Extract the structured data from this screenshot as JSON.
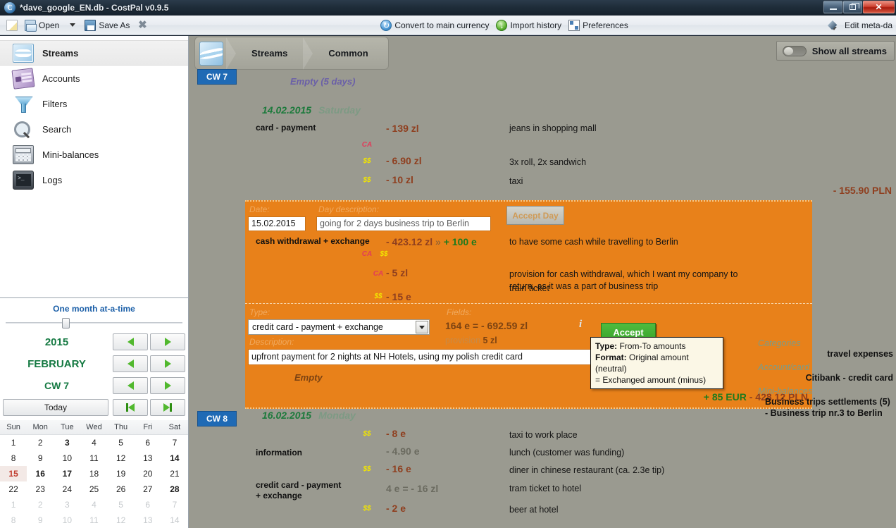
{
  "window": {
    "title": "*dave_google_EN.db - CostPal v0.9.5",
    "icon": "app-icon",
    "minimize": "minimize",
    "maximize": "restore",
    "close": "close"
  },
  "toolbar": {
    "new_label": "",
    "open_label": "Open",
    "save_as_label": "Save As",
    "close_db_label": "",
    "convert_label": "Convert to main currency",
    "import_label": "Import history",
    "preferences_label": "Preferences",
    "edit_meta_label": "Edit meta-da"
  },
  "sidebar": {
    "items": [
      {
        "label": "Streams",
        "icon": "streams-icon",
        "selected": true
      },
      {
        "label": "Accounts",
        "icon": "accounts-icon",
        "selected": false
      },
      {
        "label": "Filters",
        "icon": "filters-icon",
        "selected": false
      },
      {
        "label": "Search",
        "icon": "search-icon",
        "selected": false
      },
      {
        "label": "Mini-balances",
        "icon": "mini-balances-icon",
        "selected": false
      },
      {
        "label": "Logs",
        "icon": "logs-icon",
        "selected": false
      }
    ]
  },
  "calendar": {
    "granularity_label": "One month at-a-time",
    "year": "2015",
    "month": "FEBRUARY",
    "week": "CW 7",
    "today_label": "Today",
    "weekday_headers": [
      "Sun",
      "Mon",
      "Tue",
      "Wed",
      "Thu",
      "Fri",
      "Sat"
    ],
    "weeks": [
      [
        {
          "d": "1",
          "s": "normal"
        },
        {
          "d": "2",
          "s": "normal"
        },
        {
          "d": "3",
          "s": "bold"
        },
        {
          "d": "4",
          "s": "normal"
        },
        {
          "d": "5",
          "s": "normal"
        },
        {
          "d": "6",
          "s": "normal"
        },
        {
          "d": "7",
          "s": "normal"
        }
      ],
      [
        {
          "d": "8",
          "s": "normal"
        },
        {
          "d": "9",
          "s": "normal"
        },
        {
          "d": "10",
          "s": "normal"
        },
        {
          "d": "11",
          "s": "normal"
        },
        {
          "d": "12",
          "s": "normal"
        },
        {
          "d": "13",
          "s": "normal"
        },
        {
          "d": "14",
          "s": "bold"
        }
      ],
      [
        {
          "d": "15",
          "s": "selected"
        },
        {
          "d": "16",
          "s": "bold"
        },
        {
          "d": "17",
          "s": "bold"
        },
        {
          "d": "18",
          "s": "normal"
        },
        {
          "d": "19",
          "s": "normal"
        },
        {
          "d": "20",
          "s": "normal"
        },
        {
          "d": "21",
          "s": "normal"
        }
      ],
      [
        {
          "d": "22",
          "s": "normal"
        },
        {
          "d": "23",
          "s": "normal"
        },
        {
          "d": "24",
          "s": "normal"
        },
        {
          "d": "25",
          "s": "normal"
        },
        {
          "d": "26",
          "s": "normal"
        },
        {
          "d": "27",
          "s": "normal"
        },
        {
          "d": "28",
          "s": "bold"
        }
      ],
      [
        {
          "d": "1",
          "s": "muted"
        },
        {
          "d": "2",
          "s": "muted"
        },
        {
          "d": "3",
          "s": "muted"
        },
        {
          "d": "4",
          "s": "muted"
        },
        {
          "d": "5",
          "s": "muted"
        },
        {
          "d": "6",
          "s": "muted"
        },
        {
          "d": "7",
          "s": "muted"
        }
      ],
      [
        {
          "d": "8",
          "s": "muted"
        },
        {
          "d": "9",
          "s": "muted"
        },
        {
          "d": "10",
          "s": "muted"
        },
        {
          "d": "11",
          "s": "muted"
        },
        {
          "d": "12",
          "s": "muted"
        },
        {
          "d": "13",
          "s": "muted"
        },
        {
          "d": "14",
          "s": "muted"
        }
      ]
    ]
  },
  "breadcrumb": {
    "logo": "streams-logo",
    "items": [
      "Streams",
      "Common"
    ]
  },
  "show_all_streams": {
    "label": "Show all streams",
    "state": "off"
  },
  "stream": {
    "week_badge_top": "CW 7",
    "week_badge_bottom": "CW 8",
    "empty_note": "Empty (5 days)",
    "day1": {
      "date": "14.02.2015",
      "weekday": "Saturday",
      "rows": [
        {
          "type": "card - payment",
          "flag": "",
          "amount": "- 139 zl",
          "desc": "jeans in shopping mall"
        },
        {
          "type": "",
          "flag": "CA",
          "amount": "",
          "desc": ""
        },
        {
          "type": "",
          "flag": "$$",
          "amount": "- 6.90 zl",
          "desc": "3x roll, 2x sandwich"
        },
        {
          "type": "",
          "flag": "$$",
          "amount": "- 10 zl",
          "desc": "taxi"
        }
      ],
      "total": "- 155.90 PLN"
    },
    "day2": {
      "date": "16.02.2015",
      "weekday": "Monday",
      "rows": [
        {
          "type": "",
          "flag": "$$",
          "amount": "- 8 e",
          "desc": "taxi to work place"
        },
        {
          "type": "information",
          "flag": "",
          "amount": "- 4.90 e",
          "desc": "lunch (customer was funding)"
        },
        {
          "type": "",
          "flag": "$$",
          "amount": "- 16 e",
          "desc": "diner in chinese restaurant (ca. 2.3e tip)"
        },
        {
          "type": "credit card - payment + exchange",
          "flag": "",
          "amount": "4 e = - 16 zl",
          "desc": "tram ticket to hotel"
        },
        {
          "type": "",
          "flag": "$$",
          "amount": "- 2 e",
          "desc": "beer at hotel"
        }
      ]
    }
  },
  "edit_panel": {
    "date_label": "Date:",
    "date_value": "15.02.2015",
    "day_desc_label": "Day description:",
    "day_desc_value": "going for 2 days business trip to Berlin",
    "accept_day_label": "Accept Day",
    "rows": [
      {
        "type": "cash withdrawal + exchange",
        "flag": "",
        "amount_from": "- 423.12 zl",
        "amount_sep": "»",
        "amount_to": "+ 100 e",
        "desc": "to have some cash while travelling to Berlin"
      },
      {
        "type": "",
        "flag": "CA $$",
        "amount_from": "",
        "amount_sep": "",
        "amount_to": "",
        "desc": ""
      },
      {
        "type": "",
        "flag": "CA",
        "amount_from": "- 5 zl",
        "amount_sep": "",
        "amount_to": "",
        "desc": "provision for cash withdrawal, which I want my company to return, as it was a part of business trip"
      },
      {
        "type": "",
        "flag": "$$",
        "amount_from": "- 15 e",
        "amount_sep": "",
        "amount_to": "",
        "desc": "train ticket"
      }
    ],
    "type_label": "Type:",
    "type_value": "credit card - payment + exchange",
    "description_label": "Description:",
    "description_value": "upfront payment for 2 nights at NH Hotels, using my polish credit card",
    "fields_label": "Fields:",
    "fields_value": "164 e = - 692.59 zl",
    "fields_provision_prefix": "provision",
    "fields_provision_value": "5 zl",
    "info_icon": "i",
    "accept_label": "Accept",
    "empty_label": "Empty",
    "total_eur": "+ 85 EUR",
    "total_pln": "- 428.12 PLN"
  },
  "tooltip": {
    "line1_label": "Type:",
    "line1_value": "From-To amounts",
    "line2_label": "Format:",
    "line2_value": "Original amount (neutral)",
    "line3": "= Exchanged amount (minus)"
  },
  "meta": {
    "categories_label": "Categories",
    "categories_value": "travel expenses",
    "account_label": "Account/card",
    "account_value": "Citibank - credit card",
    "minibalances_label": "Mini-balances",
    "minibalances_value": "Business trips settlements (5) - Business trip nr.3 to Berlin"
  },
  "colors": {
    "accent_orange": "#e8811a",
    "accept_green": "#3aa52d",
    "badge_blue": "#1f6ab5",
    "amount_brown": "#8f3f1f",
    "positive_green": "#1d7a1d",
    "background_grey": "#9a9a90"
  }
}
